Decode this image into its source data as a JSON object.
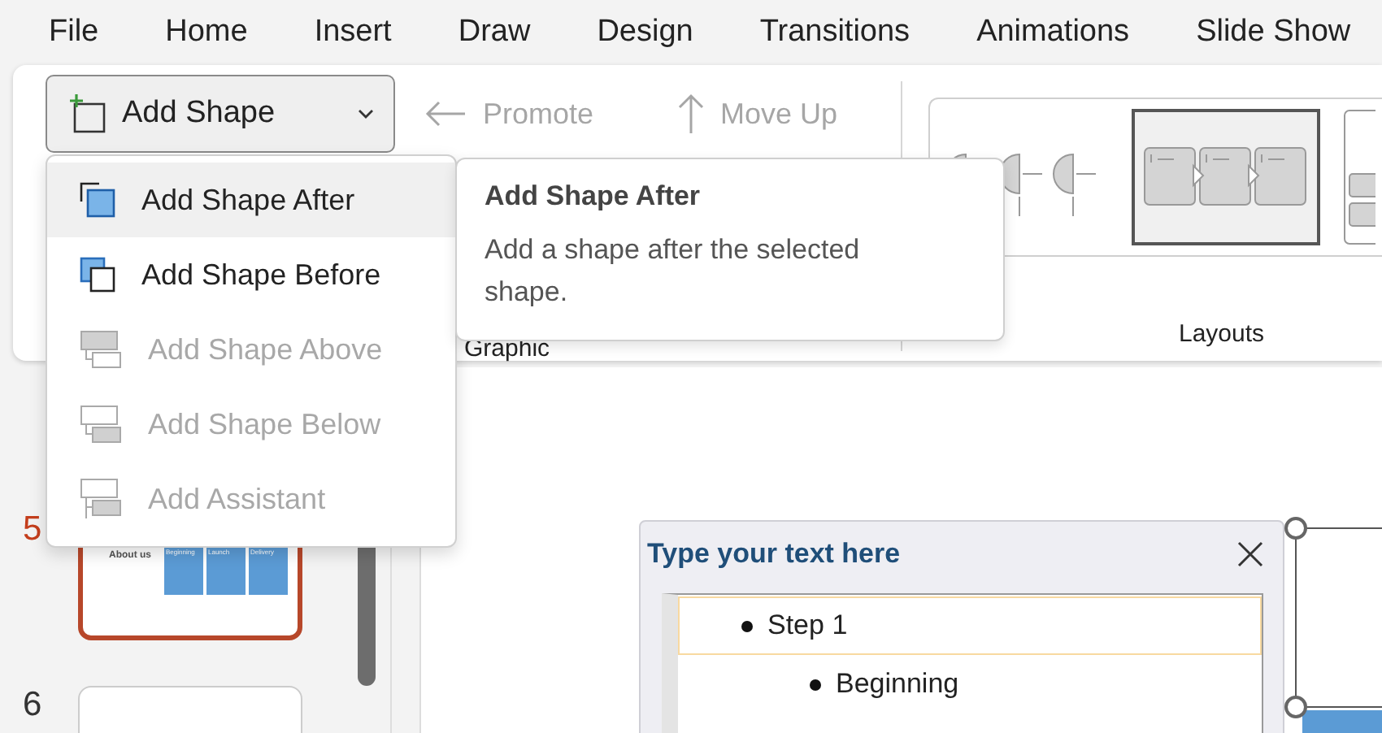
{
  "menu_bar": {
    "tabs": [
      {
        "label": "File"
      },
      {
        "label": "Home"
      },
      {
        "label": "Insert"
      },
      {
        "label": "Draw"
      },
      {
        "label": "Design"
      },
      {
        "label": "Transitions"
      },
      {
        "label": "Animations"
      },
      {
        "label": "Slide Show"
      }
    ]
  },
  "ribbon": {
    "add_shape_button": {
      "label": "Add Shape",
      "expanded": true
    },
    "tools": [
      {
        "kind": "promote",
        "label": "Promote",
        "disabled": true
      },
      {
        "kind": "move-up",
        "label": "Move Up",
        "disabled": true
      }
    ],
    "graphic_group_label": "Graphic",
    "layouts": {
      "items": [
        {
          "kind": "half-circles",
          "selected": false
        },
        {
          "kind": "process",
          "selected": true
        },
        {
          "kind": "stacked",
          "selected": false
        }
      ],
      "label": "Layouts"
    }
  },
  "add_shape_menu": {
    "items": [
      {
        "kind": "after",
        "label": "Add Shape After",
        "disabled": false,
        "selected": true
      },
      {
        "kind": "before",
        "label": "Add Shape Before",
        "disabled": false,
        "selected": false
      },
      {
        "kind": "above",
        "label": "Add Shape Above",
        "disabled": true,
        "selected": false
      },
      {
        "kind": "below",
        "label": "Add Shape Below",
        "disabled": true,
        "selected": false
      },
      {
        "kind": "assistant",
        "label": "Add Assistant",
        "disabled": true,
        "selected": false
      }
    ]
  },
  "tooltip": {
    "title": "Add Shape After",
    "description": "Add a shape after the selected shape."
  },
  "slides": [
    {
      "number": "5",
      "selected": true,
      "title": "About us",
      "boxes": [
        "Beginning",
        "Launch",
        "Delivery"
      ]
    },
    {
      "number": "6",
      "selected": false
    }
  ],
  "text_pane": {
    "title": "Type your text here",
    "items": [
      {
        "text": "Step 1",
        "selected": true,
        "children": [
          {
            "text": "Beginning",
            "selected": false
          }
        ]
      }
    ]
  }
}
